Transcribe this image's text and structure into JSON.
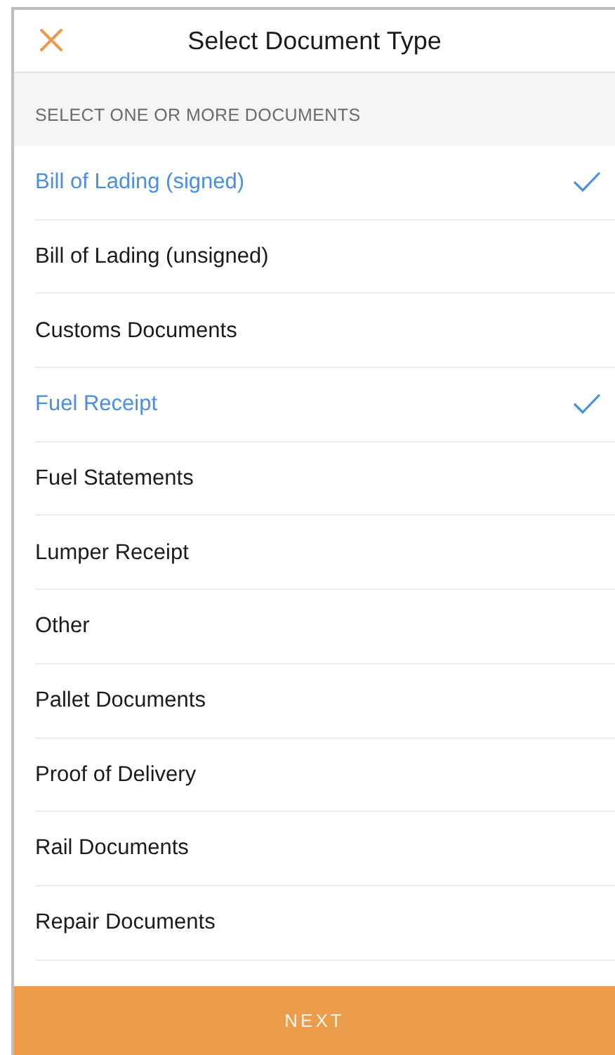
{
  "header": {
    "title": "Select Document Type"
  },
  "section_label": "SELECT ONE OR MORE DOCUMENTS",
  "documents": [
    {
      "label": "Bill of Lading (signed)",
      "selected": true
    },
    {
      "label": "Bill of Lading (unsigned)",
      "selected": false
    },
    {
      "label": "Customs Documents",
      "selected": false
    },
    {
      "label": "Fuel Receipt",
      "selected": true
    },
    {
      "label": "Fuel Statements",
      "selected": false
    },
    {
      "label": "Lumper Receipt",
      "selected": false
    },
    {
      "label": "Other",
      "selected": false
    },
    {
      "label": "Pallet Documents",
      "selected": false
    },
    {
      "label": "Proof of Delivery",
      "selected": false
    },
    {
      "label": "Rail Documents",
      "selected": false
    },
    {
      "label": "Repair Documents",
      "selected": false
    }
  ],
  "next_button": "NEXT"
}
